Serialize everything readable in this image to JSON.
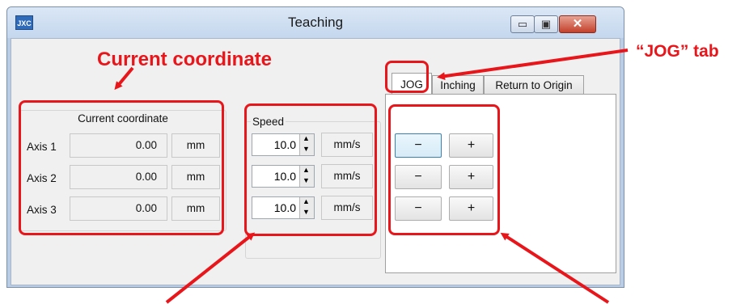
{
  "window": {
    "title": "Teaching",
    "app_icon_text": "JXC",
    "close_glyph": "✕",
    "min_glyph": "▭",
    "max_glyph": "▣"
  },
  "coordinate": {
    "group_title": "Current coordinate",
    "rows": [
      {
        "axis": "Axis 1",
        "value": "0.00",
        "unit": "mm"
      },
      {
        "axis": "Axis 2",
        "value": "0.00",
        "unit": "mm"
      },
      {
        "axis": "Axis 3",
        "value": "0.00",
        "unit": "mm"
      }
    ]
  },
  "speed": {
    "group_title": "Speed",
    "rows": [
      {
        "value": "10.0",
        "unit": "mm/s"
      },
      {
        "value": "10.0",
        "unit": "mm/s"
      },
      {
        "value": "10.0",
        "unit": "mm/s"
      }
    ]
  },
  "tabs": [
    "JOG",
    "Inching",
    "Return to Origin"
  ],
  "jog": {
    "minus_label": "−",
    "plus_label": "+"
  },
  "annotations": {
    "current_coordinate": "Current coordinate",
    "jog_tab": "“JOG” tab"
  },
  "colors": {
    "annotation": "#e8161b",
    "titlebar": "#c4d7ee"
  }
}
